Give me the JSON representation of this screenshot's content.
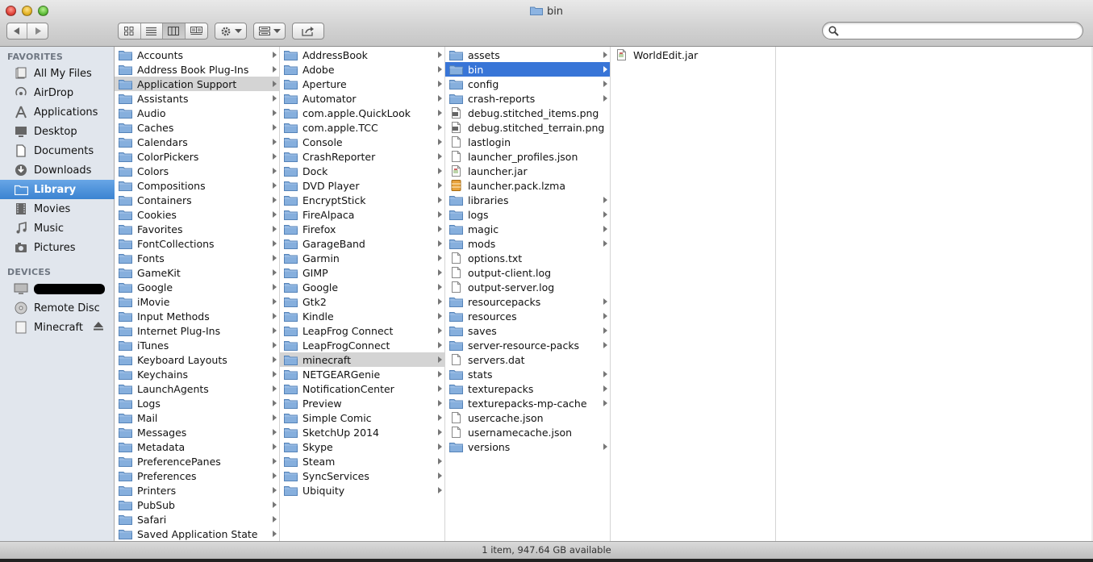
{
  "window": {
    "title": "bin"
  },
  "search": {
    "placeholder": "",
    "value": ""
  },
  "toolbar": {
    "back_icon": "back-arrow-icon",
    "forward_icon": "forward-arrow-icon",
    "view_modes": [
      "icon-view-icon",
      "list-view-icon",
      "column-view-icon",
      "coverflow-view-icon"
    ],
    "active_view": "column-view-icon"
  },
  "sidebar": {
    "favorites_heading": "FAVORITES",
    "favorites": [
      {
        "label": "All My Files",
        "icon": "all-files-icon"
      },
      {
        "label": "AirDrop",
        "icon": "airdrop-icon"
      },
      {
        "label": "Applications",
        "icon": "applications-icon"
      },
      {
        "label": "Desktop",
        "icon": "desktop-icon"
      },
      {
        "label": "Documents",
        "icon": "documents-icon"
      },
      {
        "label": "Downloads",
        "icon": "downloads-icon"
      },
      {
        "label": "Library",
        "icon": "folder-icon",
        "selected": true
      },
      {
        "label": "Movies",
        "icon": "movies-icon"
      },
      {
        "label": "Music",
        "icon": "music-icon"
      },
      {
        "label": "Pictures",
        "icon": "pictures-icon"
      }
    ],
    "devices_heading": "DEVICES",
    "devices": [
      {
        "label": "",
        "icon": "computer-icon",
        "redacted": true
      },
      {
        "label": "Remote Disc",
        "icon": "disc-icon"
      },
      {
        "label": "Minecraft",
        "icon": "drive-icon",
        "eject": true
      }
    ]
  },
  "columns": [
    {
      "items": [
        {
          "name": "Accounts",
          "type": "folder"
        },
        {
          "name": "Address Book Plug-Ins",
          "type": "folder"
        },
        {
          "name": "Application Support",
          "type": "folder",
          "state": "path"
        },
        {
          "name": "Assistants",
          "type": "folder"
        },
        {
          "name": "Audio",
          "type": "folder"
        },
        {
          "name": "Caches",
          "type": "folder"
        },
        {
          "name": "Calendars",
          "type": "folder"
        },
        {
          "name": "ColorPickers",
          "type": "folder"
        },
        {
          "name": "Colors",
          "type": "folder"
        },
        {
          "name": "Compositions",
          "type": "folder"
        },
        {
          "name": "Containers",
          "type": "folder"
        },
        {
          "name": "Cookies",
          "type": "folder"
        },
        {
          "name": "Favorites",
          "type": "folder"
        },
        {
          "name": "FontCollections",
          "type": "folder"
        },
        {
          "name": "Fonts",
          "type": "folder"
        },
        {
          "name": "GameKit",
          "type": "folder"
        },
        {
          "name": "Google",
          "type": "folder"
        },
        {
          "name": "iMovie",
          "type": "folder"
        },
        {
          "name": "Input Methods",
          "type": "folder"
        },
        {
          "name": "Internet Plug-Ins",
          "type": "folder"
        },
        {
          "name": "iTunes",
          "type": "folder"
        },
        {
          "name": "Keyboard Layouts",
          "type": "folder"
        },
        {
          "name": "Keychains",
          "type": "folder"
        },
        {
          "name": "LaunchAgents",
          "type": "folder"
        },
        {
          "name": "Logs",
          "type": "folder"
        },
        {
          "name": "Mail",
          "type": "folder"
        },
        {
          "name": "Messages",
          "type": "folder"
        },
        {
          "name": "Metadata",
          "type": "folder"
        },
        {
          "name": "PreferencePanes",
          "type": "folder"
        },
        {
          "name": "Preferences",
          "type": "folder"
        },
        {
          "name": "Printers",
          "type": "folder"
        },
        {
          "name": "PubSub",
          "type": "folder"
        },
        {
          "name": "Safari",
          "type": "folder"
        },
        {
          "name": "Saved Application State",
          "type": "folder"
        }
      ]
    },
    {
      "items": [
        {
          "name": "AddressBook",
          "type": "folder"
        },
        {
          "name": "Adobe",
          "type": "folder"
        },
        {
          "name": "Aperture",
          "type": "folder"
        },
        {
          "name": "Automator",
          "type": "folder"
        },
        {
          "name": "com.apple.QuickLook",
          "type": "folder"
        },
        {
          "name": "com.apple.TCC",
          "type": "folder"
        },
        {
          "name": "Console",
          "type": "folder"
        },
        {
          "name": "CrashReporter",
          "type": "folder"
        },
        {
          "name": "Dock",
          "type": "folder"
        },
        {
          "name": "DVD Player",
          "type": "folder"
        },
        {
          "name": "EncryptStick",
          "type": "folder"
        },
        {
          "name": "FireAlpaca",
          "type": "folder"
        },
        {
          "name": "Firefox",
          "type": "folder"
        },
        {
          "name": "GarageBand",
          "type": "folder"
        },
        {
          "name": "Garmin",
          "type": "folder"
        },
        {
          "name": "GIMP",
          "type": "folder"
        },
        {
          "name": "Google",
          "type": "folder"
        },
        {
          "name": "Gtk2",
          "type": "folder"
        },
        {
          "name": "Kindle",
          "type": "folder"
        },
        {
          "name": "LeapFrog Connect",
          "type": "folder"
        },
        {
          "name": "LeapFrogConnect",
          "type": "folder"
        },
        {
          "name": "minecraft",
          "type": "folder",
          "state": "path"
        },
        {
          "name": "NETGEARGenie",
          "type": "folder"
        },
        {
          "name": "NotificationCenter",
          "type": "folder"
        },
        {
          "name": "Preview",
          "type": "folder"
        },
        {
          "name": "Simple Comic",
          "type": "folder"
        },
        {
          "name": "SketchUp 2014",
          "type": "folder"
        },
        {
          "name": "Skype",
          "type": "folder"
        },
        {
          "name": "Steam",
          "type": "folder"
        },
        {
          "name": "SyncServices",
          "type": "folder"
        },
        {
          "name": "Ubiquity",
          "type": "folder"
        }
      ]
    },
    {
      "items": [
        {
          "name": "assets",
          "type": "folder"
        },
        {
          "name": "bin",
          "type": "folder",
          "state": "active"
        },
        {
          "name": "config",
          "type": "folder"
        },
        {
          "name": "crash-reports",
          "type": "folder"
        },
        {
          "name": "debug.stitched_items.png",
          "type": "image"
        },
        {
          "name": "debug.stitched_terrain.png",
          "type": "image"
        },
        {
          "name": "lastlogin",
          "type": "file"
        },
        {
          "name": "launcher_profiles.json",
          "type": "file"
        },
        {
          "name": "launcher.jar",
          "type": "jar"
        },
        {
          "name": "launcher.pack.lzma",
          "type": "archive"
        },
        {
          "name": "libraries",
          "type": "folder"
        },
        {
          "name": "logs",
          "type": "folder"
        },
        {
          "name": "magic",
          "type": "folder"
        },
        {
          "name": "mods",
          "type": "folder"
        },
        {
          "name": "options.txt",
          "type": "file"
        },
        {
          "name": "output-client.log",
          "type": "file"
        },
        {
          "name": "output-server.log",
          "type": "file"
        },
        {
          "name": "resourcepacks",
          "type": "folder"
        },
        {
          "name": "resources",
          "type": "folder"
        },
        {
          "name": "saves",
          "type": "folder"
        },
        {
          "name": "server-resource-packs",
          "type": "folder"
        },
        {
          "name": "servers.dat",
          "type": "file"
        },
        {
          "name": "stats",
          "type": "folder"
        },
        {
          "name": "texturepacks",
          "type": "folder"
        },
        {
          "name": "texturepacks-mp-cache",
          "type": "folder"
        },
        {
          "name": "usercache.json",
          "type": "file"
        },
        {
          "name": "usernamecache.json",
          "type": "file"
        },
        {
          "name": "versions",
          "type": "folder"
        }
      ]
    },
    {
      "items": [
        {
          "name": "WorldEdit.jar",
          "type": "jar"
        }
      ]
    },
    {
      "items": []
    }
  ],
  "status": {
    "text": "1 item, 947.64 GB available"
  },
  "colors": {
    "selection": "#3875d7",
    "sidebar": "#e1e6ed",
    "folder": "#7aa5d6"
  }
}
